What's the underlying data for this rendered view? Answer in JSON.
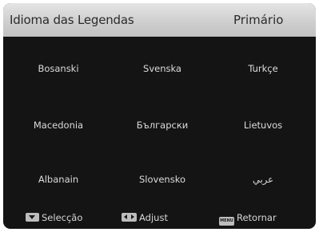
{
  "header": {
    "title": "Idioma das Legendas",
    "value": "Primário"
  },
  "languages": [
    [
      "Bosanski",
      "Svenska",
      "Turkçe"
    ],
    [
      "Macedonia",
      "Български",
      "Lietuvos"
    ],
    [
      "Albanain",
      "Slovensko",
      "عربي"
    ]
  ],
  "footer": {
    "select_label": "Selecção",
    "adjust_label": "Adjust",
    "return_label": "Retornar",
    "menu_key_label": "MENU"
  },
  "icons": {
    "select": "down-arrow-key-icon",
    "adjust": "left-right-key-icon",
    "return": "menu-key-icon"
  }
}
